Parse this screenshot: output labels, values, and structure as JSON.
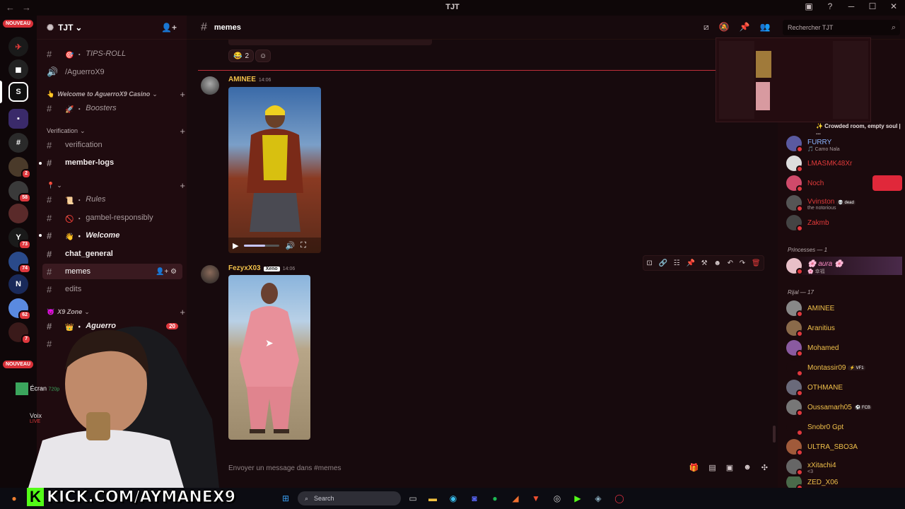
{
  "window": {
    "title": "TJT"
  },
  "rail": {
    "new_label": "NOUVEAU",
    "badges": [
      "2",
      "58",
      "73",
      "74",
      "62",
      "7"
    ]
  },
  "server": {
    "name": "TJT",
    "chevron": "⌄"
  },
  "channels": [
    {
      "name": "TIPS-ROLL",
      "prefix": "🎯 ・"
    },
    {
      "name": "/AguerroX9",
      "type": "voice"
    },
    {
      "name": "Boosters",
      "prefix": "🚀 ・"
    },
    {
      "name": "verification"
    },
    {
      "name": "member-logs"
    },
    {
      "name": "Rules",
      "prefix": "📜 ・"
    },
    {
      "name": "gambel-responsibly",
      "prefix": "🚫 ・"
    },
    {
      "name": "Welcome",
      "prefix": "👋 ・"
    },
    {
      "name": "chat_general"
    },
    {
      "name": "memes"
    },
    {
      "name": "edits"
    },
    {
      "name": "Aguerro",
      "prefix": "👑 ・",
      "badge": "20"
    }
  ],
  "categories": {
    "welcome": "Welcome to AguerroX9 Casino",
    "verification": "Verification",
    "pin": "📍",
    "x9zone": "X9 Zone"
  },
  "voice": {
    "screen": "Écran",
    "screen_sub": "720p",
    "voice": "Voix",
    "live": "LIVE"
  },
  "chat": {
    "channel": "memes",
    "search_placeholder": "Rechercher TJT",
    "composer_placeholder": "Envoyer un message dans #memes",
    "reactions": [
      {
        "emoji": "😂",
        "count": "2"
      }
    ],
    "messages": [
      {
        "author": "AMINEE",
        "time": "14:06",
        "attachment": "video"
      },
      {
        "author": "FezyxX03",
        "tag": "Xeno",
        "time": "14:06",
        "attachment": "image"
      }
    ]
  },
  "members": {
    "status_line": "✨ Crowded room, empty soul | ...",
    "groups": [
      {
        "label": "Princesses — 1"
      },
      {
        "label": "Rijal — 17"
      }
    ],
    "list": [
      {
        "name": "FURRY",
        "sub": "🎵 Camo Nala",
        "color": "#8ab4ff"
      },
      {
        "name": "LMASMK48Xr",
        "color": "#e03a3a"
      },
      {
        "name": "Noch",
        "color": "#e03a3a"
      },
      {
        "name": "Vvinston",
        "tag": "💀 dead",
        "sub": "the notorious",
        "color": "#e03a3a"
      },
      {
        "name": "Zakmb",
        "color": "#e03a3a"
      },
      {
        "name": "🌸 aura 🌸",
        "sub": "🌸 幸福",
        "color": "#ff8fc8"
      },
      {
        "name": "AMINEE",
        "color": "#f0c04a"
      },
      {
        "name": "Aranitius",
        "color": "#f0c04a"
      },
      {
        "name": "Mohamed",
        "color": "#f0c04a"
      },
      {
        "name": "Montassir09",
        "tag": "⚡ VF1",
        "color": "#f0c04a"
      },
      {
        "name": "OTHMANE",
        "color": "#f0c04a"
      },
      {
        "name": "Oussamarh05",
        "tag": "⚽ FCB",
        "color": "#f0c04a"
      },
      {
        "name": "Snobr0 Gpt",
        "color": "#f0c04a"
      },
      {
        "name": "ULTRA_SBO3A",
        "color": "#f0c04a"
      },
      {
        "name": "xXitachi4",
        "sub": "<3",
        "color": "#f0c04a"
      },
      {
        "name": "ZED_X06",
        "color": "#f0c04a"
      }
    ]
  },
  "taskbar": {
    "search_placeholder": "Search"
  },
  "overlay": {
    "stream_url": "KICK.COM/AYMANEX9"
  },
  "colors": {
    "accent": "#e0383e",
    "brand_kick": "#53fc18",
    "author_gold": "#f0c04a"
  }
}
